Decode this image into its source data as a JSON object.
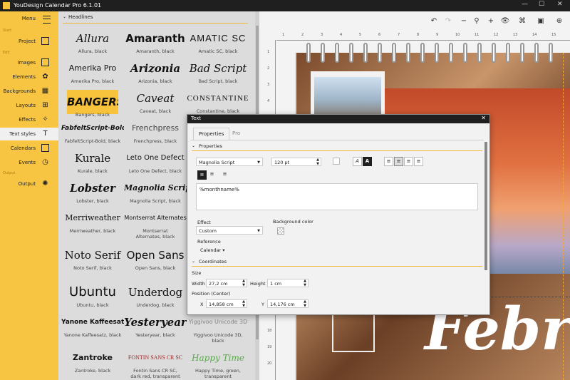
{
  "app": {
    "title": "YouDesign Calendar Pro 6.1.01"
  },
  "sidebar": {
    "menu_label": "Menu",
    "sections": {
      "start": "Start",
      "edit": "Edit",
      "output": "Output"
    },
    "items": [
      {
        "label": "Project",
        "icon": "page-icon"
      },
      {
        "label": "Images",
        "icon": "image-icon"
      },
      {
        "label": "Elements",
        "icon": "elements-icon"
      },
      {
        "label": "Backgrounds",
        "icon": "background-icon"
      },
      {
        "label": "Layouts",
        "icon": "layout-icon"
      },
      {
        "label": "Effects",
        "icon": "magic-wand-icon"
      },
      {
        "label": "Text styles",
        "icon": "text-style-icon"
      },
      {
        "label": "Calendars",
        "icon": "calendar-icon"
      },
      {
        "label": "Events",
        "icon": "clock-icon"
      },
      {
        "label": "Output",
        "icon": "output-icon"
      }
    ],
    "active_item": "Text styles"
  },
  "font_panel": {
    "header": "Headlines",
    "fonts": [
      {
        "preview": "Allura",
        "caption": "Allura, black"
      },
      {
        "preview": "Amaranth",
        "caption": "Amaranth, black"
      },
      {
        "preview": "AMATIC SC",
        "caption": "Amatic SC, black"
      },
      {
        "preview": "Amerika Pro",
        "caption": "Amerika Pro, black"
      },
      {
        "preview": "Arizonia",
        "caption": "Arizonia, black"
      },
      {
        "preview": "Bad Script",
        "caption": "Bad Script, black"
      },
      {
        "preview": "BANGERS",
        "caption": "Bangers, black"
      },
      {
        "preview": "Caveat",
        "caption": "Caveat, black"
      },
      {
        "preview": "CONSTANTINE",
        "caption": "Constantine, black"
      },
      {
        "preview": "FabfeltScript-Bold",
        "caption": "FabfeltScript-Bold, black"
      },
      {
        "preview": "Frenchpress",
        "caption": "Frenchpress, black"
      },
      {
        "preview": "",
        "caption": ""
      },
      {
        "preview": "Kurale",
        "caption": "Kurale, black"
      },
      {
        "preview": "Leto One Defect",
        "caption": "Leto One Defect, black"
      },
      {
        "preview": "",
        "caption": ""
      },
      {
        "preview": "Lobster",
        "caption": "Lobster, black"
      },
      {
        "preview": "Magnolia Script",
        "caption": "Magnolia Script, black"
      },
      {
        "preview": "",
        "caption": ""
      },
      {
        "preview": "Merriweather",
        "caption": "Merriweather, black"
      },
      {
        "preview": "Montserrat Alternates",
        "caption": "Montserrat Alternates, black"
      },
      {
        "preview": "",
        "caption": ""
      },
      {
        "preview": "Noto Serif",
        "caption": "Noto Serif, black"
      },
      {
        "preview": "Open Sans",
        "caption": "Open Sans, black"
      },
      {
        "preview": "",
        "caption": ""
      },
      {
        "preview": "Ubuntu",
        "caption": "Ubuntu, black"
      },
      {
        "preview": "Underdog",
        "caption": "Underdog, black"
      },
      {
        "preview": "",
        "caption": ""
      },
      {
        "preview": "Yanone Kaffeesatz",
        "caption": "Yanone Kaffeesatz, black"
      },
      {
        "preview": "Yesteryear",
        "caption": "Yesteryear, black"
      },
      {
        "preview": "Yiggivoo Unicode 3D",
        "caption": "Yiggivoo Unicode 3D, black"
      },
      {
        "preview": "Zantroke",
        "caption": "Zantroke, black"
      },
      {
        "preview": "FONTIN SANS CR SC",
        "caption": "Fontin Sans CR SC, dark red, transparent"
      },
      {
        "preview": "Happy Time",
        "caption": "Happy Time, green, transparent"
      }
    ],
    "selected": "Bangers, black"
  },
  "toolbar": {
    "undo": "↶",
    "redo": "↷",
    "minus": "−",
    "zoom": "⚲",
    "plus": "+",
    "view": "👁",
    "cmd": "⌘"
  },
  "ruler": {
    "h": [
      "1",
      "2",
      "3",
      "4",
      "5",
      "6",
      "7",
      "8",
      "9",
      "10",
      "11",
      "12",
      "13",
      "14",
      "15"
    ],
    "v": [
      "1",
      "2",
      "3",
      "4",
      "5",
      "6",
      "7",
      "8",
      "9",
      "10",
      "11",
      "12",
      "13",
      "14",
      "15",
      "16",
      "17",
      "18",
      "19",
      "20"
    ]
  },
  "canvas": {
    "month_text": "Febr"
  },
  "dialog": {
    "title": "Text",
    "close": "✕",
    "tabs": [
      "Properties",
      "Pro"
    ],
    "properties_section": "Properties",
    "font_value": "Magnolia Script",
    "size_value": "120 pt",
    "style_a": "A",
    "style_a_bold": "A",
    "text_value": "%monthname%",
    "effect_label": "Effect",
    "effect_value": "Custom",
    "bg_color_label": "Background color",
    "reference_label": "Reference",
    "reference_value": "Calendar",
    "coordinates_section": "Coordinates",
    "size_label": "Size",
    "width_label": "Width",
    "width_value": "27,2 cm",
    "height_label": "Height",
    "height_value": "1 cm",
    "position_label": "Position (Center)",
    "x_label": "X",
    "x_value": "14,858 cm",
    "y_label": "Y",
    "y_value": "14,176 cm"
  }
}
